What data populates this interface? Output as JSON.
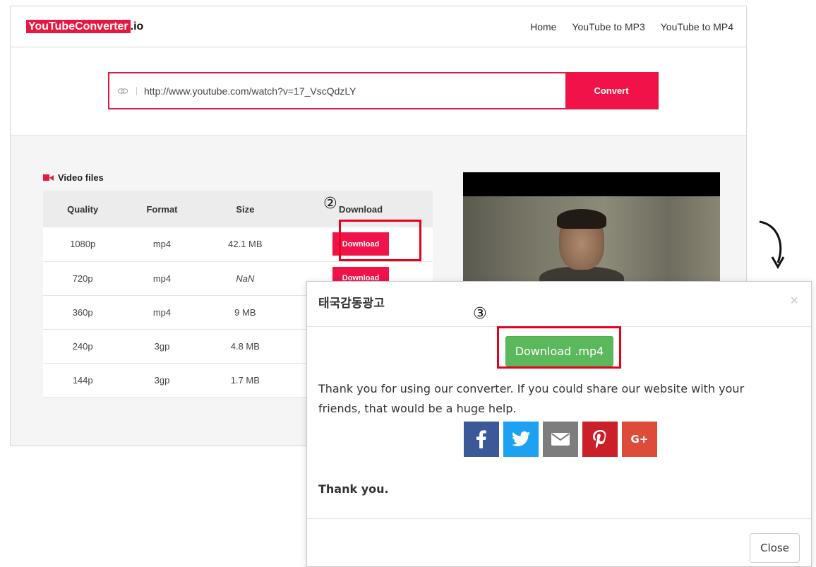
{
  "header": {
    "logo_main": "YouTubeConverter",
    "logo_suffix": ".io",
    "nav": [
      "Home",
      "YouTube to MP3",
      "YouTube to MP4"
    ]
  },
  "search": {
    "url_value": "http://www.youtube.com/watch?v=17_VscQdzLY",
    "convert_label": "Convert"
  },
  "files": {
    "title": "Video files",
    "columns": [
      "Quality",
      "Format",
      "Size",
      "Download"
    ],
    "download_label": "Download",
    "rows": [
      {
        "quality": "1080p",
        "format": "mp4",
        "size": "42.1 MB"
      },
      {
        "quality": "720p",
        "format": "mp4",
        "size": "NaN"
      },
      {
        "quality": "360p",
        "format": "mp4",
        "size": "9 MB"
      },
      {
        "quality": "240p",
        "format": "3gp",
        "size": "4.8 MB"
      },
      {
        "quality": "144p",
        "format": "3gp",
        "size": "1.7 MB"
      }
    ]
  },
  "annotations": {
    "step2": "②",
    "step3": "③"
  },
  "modal": {
    "title": "태국감동광고",
    "close_x": "×",
    "download_button": "Download .mp4",
    "message": "Thank you for using our converter. If you could share our website with your friends, that would be a huge help.",
    "share": {
      "facebook": "facebook-icon",
      "twitter": "twitter-icon",
      "email": "email-icon",
      "pinterest": "pinterest-icon",
      "googleplus": "G+"
    },
    "thank_you": "Thank you.",
    "close_label": "Close"
  },
  "colors": {
    "brand_red": "#f01248",
    "annotation_red": "#e6001e",
    "download_green": "#5cb85c"
  }
}
